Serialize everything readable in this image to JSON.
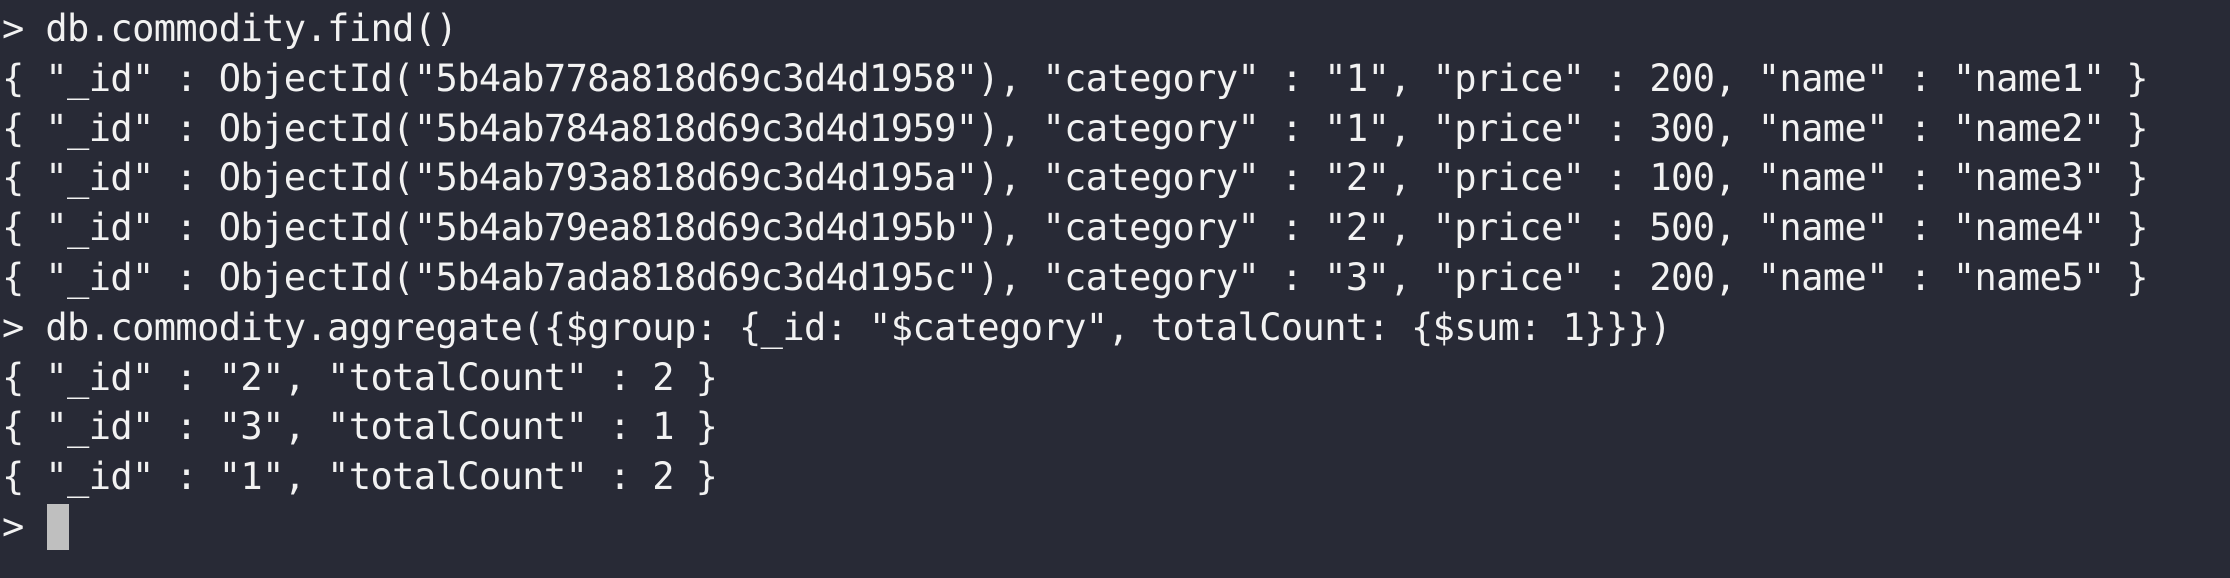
{
  "terminal": {
    "prompt": "> ",
    "lines": [
      {
        "kind": "command",
        "text": "db.commodity.find()"
      },
      {
        "kind": "output",
        "text": "{ \"_id\" : ObjectId(\"5b4ab778a818d69c3d4d1958\"), \"category\" : \"1\", \"price\" : 200, \"name\" : \"name1\" }"
      },
      {
        "kind": "output",
        "text": "{ \"_id\" : ObjectId(\"5b4ab784a818d69c3d4d1959\"), \"category\" : \"1\", \"price\" : 300, \"name\" : \"name2\" }"
      },
      {
        "kind": "output",
        "text": "{ \"_id\" : ObjectId(\"5b4ab793a818d69c3d4d195a\"), \"category\" : \"2\", \"price\" : 100, \"name\" : \"name3\" }"
      },
      {
        "kind": "output",
        "text": "{ \"_id\" : ObjectId(\"5b4ab79ea818d69c3d4d195b\"), \"category\" : \"2\", \"price\" : 500, \"name\" : \"name4\" }"
      },
      {
        "kind": "output",
        "text": "{ \"_id\" : ObjectId(\"5b4ab7ada818d69c3d4d195c\"), \"category\" : \"3\", \"price\" : 200, \"name\" : \"name5\" }"
      },
      {
        "kind": "command",
        "text": "db.commodity.aggregate({$group: {_id: \"$category\", totalCount: {$sum: 1}}})"
      },
      {
        "kind": "output",
        "text": "{ \"_id\" : \"2\", \"totalCount\" : 2 }"
      },
      {
        "kind": "output",
        "text": "{ \"_id\" : \"3\", \"totalCount\" : 1 }"
      },
      {
        "kind": "output",
        "text": "{ \"_id\" : \"1\", \"totalCount\" : 2 }"
      }
    ],
    "current_prompt": ">"
  },
  "colors": {
    "background": "#282a36",
    "foreground": "#f2f2f2",
    "cursor": "#bfbfbf"
  }
}
